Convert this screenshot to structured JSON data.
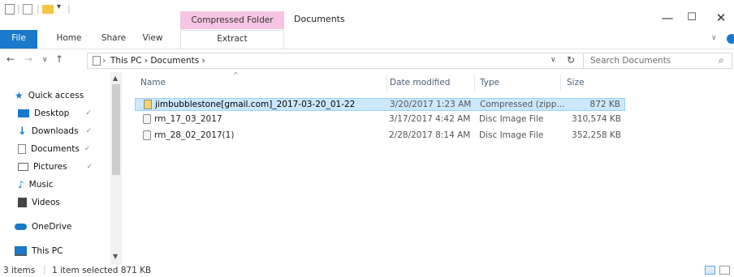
{
  "window": {
    "context_tab": "Compressed Folder Tools",
    "title": "Documents",
    "minimize": "—",
    "maximize": "☐",
    "close": "✕"
  },
  "ribbon": {
    "tabs": [
      "File",
      "Home",
      "Share",
      "View",
      "Extract"
    ]
  },
  "address": {
    "crumbs": "This PC  ›  Documents  ›",
    "search_placeholder": "Search Documents"
  },
  "nav": {
    "items": [
      {
        "label": "Quick access",
        "icon": "star-icon"
      },
      {
        "label": "Desktop",
        "icon": "desktop-icon",
        "pinned": true
      },
      {
        "label": "Downloads",
        "icon": "download-icon",
        "pinned": true
      },
      {
        "label": "Documents",
        "icon": "documents-icon",
        "pinned": true
      },
      {
        "label": "Pictures",
        "icon": "pictures-icon",
        "pinned": true
      },
      {
        "label": "Music",
        "icon": "music-icon"
      },
      {
        "label": "Videos",
        "icon": "videos-icon"
      },
      {
        "label": "OneDrive",
        "icon": "onedrive-icon"
      },
      {
        "label": "This PC",
        "icon": "computer-icon"
      }
    ]
  },
  "columns": [
    "Name",
    "Date modified",
    "Type",
    "Size"
  ],
  "files": [
    {
      "name": "jimbubblestone[gmail.com]_2017-03-20_01-22",
      "date": "3/20/2017 1:23 AM",
      "type": "Compressed (zipp...",
      "size": "872 KB",
      "icon": "zip-icon"
    },
    {
      "name": "rm_17_03_2017",
      "date": "3/17/2017 4:42 AM",
      "type": "Disc Image File",
      "size": "310,574 KB",
      "icon": "disc-image-icon"
    },
    {
      "name": "rm_28_02_2017(1)",
      "date": "2/28/2017 8:14 AM",
      "type": "Disc Image File",
      "size": "352,258 KB",
      "icon": "disc-image-icon"
    }
  ],
  "status": {
    "count": "3 items",
    "selection": "1 item selected  871 KB"
  },
  "colors": {
    "accent": "#1979ca",
    "context_tab": "#f5c5e3",
    "selection": "#cce8ff"
  }
}
